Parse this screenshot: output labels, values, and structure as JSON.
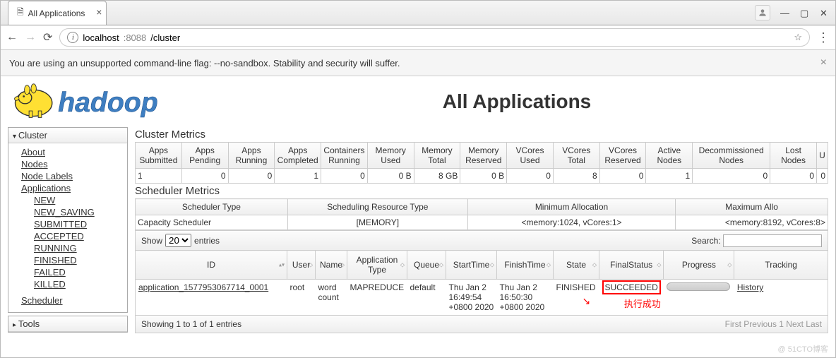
{
  "browser": {
    "tab_title": "All Applications",
    "url_host": "localhost",
    "url_port": ":8088",
    "url_path": "/cluster",
    "warning": "You are using an unsupported command-line flag: --no-sandbox. Stability and security will suffer."
  },
  "page_title": "All Applications",
  "sidebar": {
    "cluster_label": "Cluster",
    "tools_label": "Tools",
    "links": [
      "About",
      "Nodes",
      "Node Labels",
      "Applications"
    ],
    "app_states": [
      "NEW",
      "NEW_SAVING",
      "SUBMITTED",
      "ACCEPTED",
      "RUNNING",
      "FINISHED",
      "FAILED",
      "KILLED"
    ],
    "scheduler_label": "Scheduler"
  },
  "cluster_metrics": {
    "title": "Cluster Metrics",
    "headers": [
      "Apps Submitted",
      "Apps Pending",
      "Apps Running",
      "Apps Completed",
      "Containers Running",
      "Memory Used",
      "Memory Total",
      "Memory Reserved",
      "VCores Used",
      "VCores Total",
      "VCores Reserved",
      "Active Nodes",
      "Decommissioned Nodes",
      "Lost Nodes",
      "U"
    ],
    "values": [
      "1",
      "0",
      "0",
      "1",
      "0",
      "0 B",
      "8 GB",
      "0 B",
      "0",
      "8",
      "0",
      "1",
      "0",
      "0",
      "0"
    ]
  },
  "scheduler_metrics": {
    "title": "Scheduler Metrics",
    "headers": [
      "Scheduler Type",
      "Scheduling Resource Type",
      "Minimum Allocation",
      "Maximum Allo"
    ],
    "values": [
      "Capacity Scheduler",
      "[MEMORY]",
      "<memory:1024, vCores:1>",
      "<memory:8192, vCores:8>"
    ]
  },
  "apps": {
    "show_label": "Show",
    "entries_label": "entries",
    "page_size": "20",
    "search_label": "Search:",
    "headers": [
      "ID",
      "User",
      "Name",
      "Application Type",
      "Queue",
      "StartTime",
      "FinishTime",
      "State",
      "FinalStatus",
      "Progress",
      "Tracking"
    ],
    "row": {
      "id": "application_1577953067714_0001",
      "user": "root",
      "name": "word count",
      "type": "MAPREDUCE",
      "queue": "default",
      "start": "Thu Jan 2 16:49:54 +0800 2020",
      "finish": "Thu Jan 2 16:50:30 +0800 2020",
      "state": "FINISHED",
      "final": "SUCCEEDED",
      "tracking": "History"
    },
    "footer_info": "Showing 1 to 1 of 1 entries",
    "pager": "First Previous 1 Next Last"
  },
  "annotation": "执行成功",
  "watermark": "@ 51CTO博客"
}
